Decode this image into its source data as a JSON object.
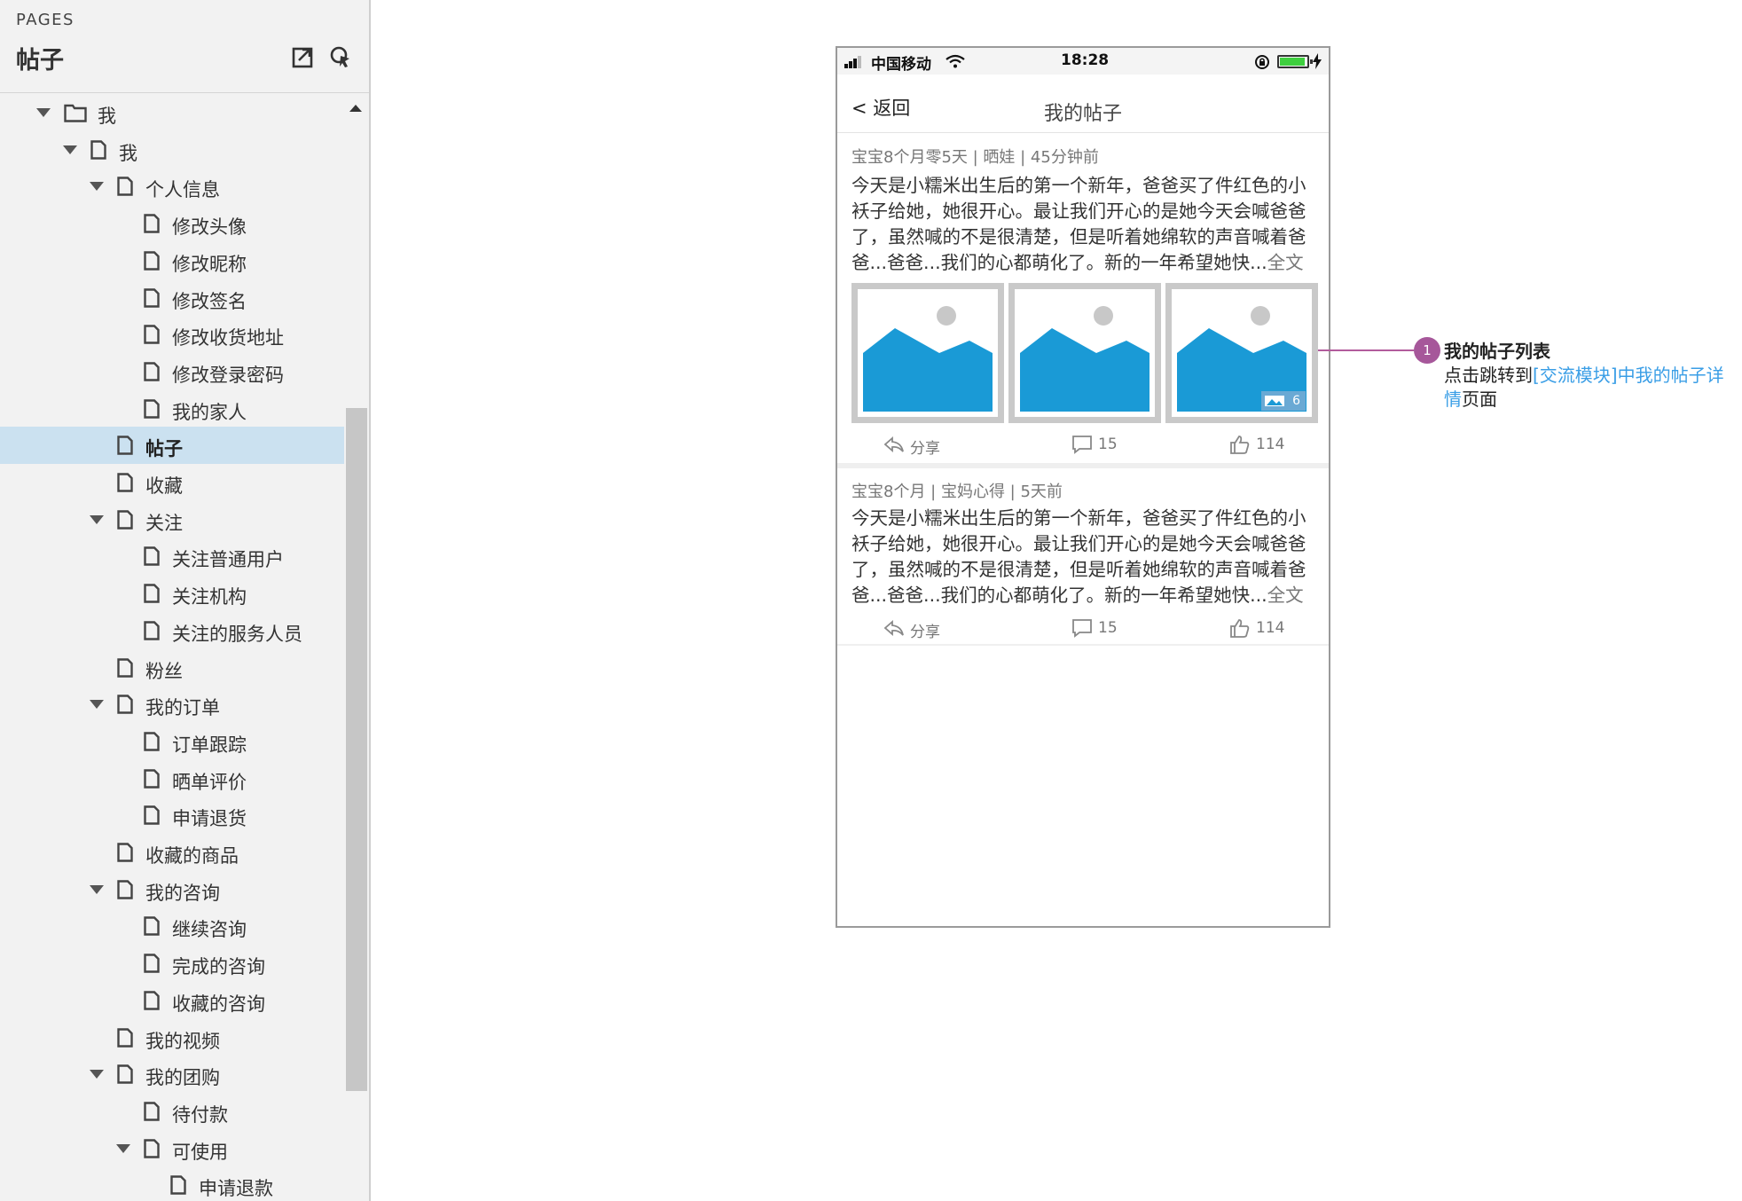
{
  "sidebar": {
    "pages_label": "PAGES",
    "title": "帖子",
    "tree": [
      {
        "label": "我",
        "level": 0,
        "type": "folder",
        "expanded": true
      },
      {
        "label": "我",
        "level": 1,
        "type": "page",
        "expanded": true
      },
      {
        "label": "个人信息",
        "level": 2,
        "type": "page",
        "expanded": true
      },
      {
        "label": "修改头像",
        "level": 3,
        "type": "page"
      },
      {
        "label": "修改昵称",
        "level": 3,
        "type": "page"
      },
      {
        "label": "修改签名",
        "level": 3,
        "type": "page"
      },
      {
        "label": "修改收货地址",
        "level": 3,
        "type": "page"
      },
      {
        "label": "修改登录密码",
        "level": 3,
        "type": "page"
      },
      {
        "label": "我的家人",
        "level": 3,
        "type": "page"
      },
      {
        "label": "帖子",
        "level": 2,
        "type": "page",
        "selected": true
      },
      {
        "label": "收藏",
        "level": 2,
        "type": "page"
      },
      {
        "label": "关注",
        "level": 2,
        "type": "page",
        "expanded": true
      },
      {
        "label": "关注普通用户",
        "level": 3,
        "type": "page"
      },
      {
        "label": "关注机构",
        "level": 3,
        "type": "page"
      },
      {
        "label": "关注的服务人员",
        "level": 3,
        "type": "page"
      },
      {
        "label": "粉丝",
        "level": 2,
        "type": "page"
      },
      {
        "label": "我的订单",
        "level": 2,
        "type": "page",
        "expanded": true
      },
      {
        "label": "订单跟踪",
        "level": 3,
        "type": "page"
      },
      {
        "label": "晒单评价",
        "level": 3,
        "type": "page"
      },
      {
        "label": "申请退货",
        "level": 3,
        "type": "page"
      },
      {
        "label": "收藏的商品",
        "level": 2,
        "type": "page"
      },
      {
        "label": "我的咨询",
        "level": 2,
        "type": "page",
        "expanded": true
      },
      {
        "label": "继续咨询",
        "level": 3,
        "type": "page"
      },
      {
        "label": "完成的咨询",
        "level": 3,
        "type": "page"
      },
      {
        "label": "收藏的咨询",
        "level": 3,
        "type": "page"
      },
      {
        "label": "我的视频",
        "level": 2,
        "type": "page"
      },
      {
        "label": "我的团购",
        "level": 2,
        "type": "page",
        "expanded": true
      },
      {
        "label": "待付款",
        "level": 3,
        "type": "page"
      },
      {
        "label": "可使用",
        "level": 3,
        "type": "page",
        "expanded": true
      },
      {
        "label": "申请退款",
        "level": 4,
        "type": "page"
      }
    ]
  },
  "phone": {
    "status": {
      "carrier": "中国移动",
      "time": "18:28"
    },
    "nav": {
      "back": "< 返回",
      "title": "我的帖子"
    },
    "posts": [
      {
        "meta": "宝宝8个月零5天 |  晒娃  |  45分钟前",
        "body": "今天是小糯米出生后的第一个新年，爸爸买了件红色的小袄子给她，她很开心。最让我们开心的是她今天会喊爸爸了，虽然喊的不是很清楚，但是听着她绵软的声音喊着爸爸...爸爸...我们的心都萌化了。新的一年希望她快...",
        "more": "全文",
        "image_count": "6",
        "share": "分享",
        "comments": "15",
        "likes": "114"
      },
      {
        "meta": "宝宝8个月 |  宝妈心得  |  5天前",
        "body": "今天是小糯米出生后的第一个新年，爸爸买了件红色的小袄子给她，她很开心。最让我们开心的是她今天会喊爸爸了，虽然喊的不是很清楚，但是听着她绵软的声音喊着爸爸...爸爸...我们的心都萌化了。新的一年希望她快...",
        "more": "全文",
        "share": "分享",
        "comments": "15",
        "likes": "114"
      }
    ]
  },
  "annotation": {
    "badge": "1",
    "title": "我的帖子列表",
    "desc_prefix": "点击跳转到",
    "desc_link": "[交流模块]中我的帖子详情",
    "desc_suffix": "页面"
  },
  "colors": {
    "selected_row": "#cbe1f0",
    "image_blue": "#1a9ad6",
    "annotation_accent": "#a6579a",
    "link": "#3a9ee6"
  }
}
